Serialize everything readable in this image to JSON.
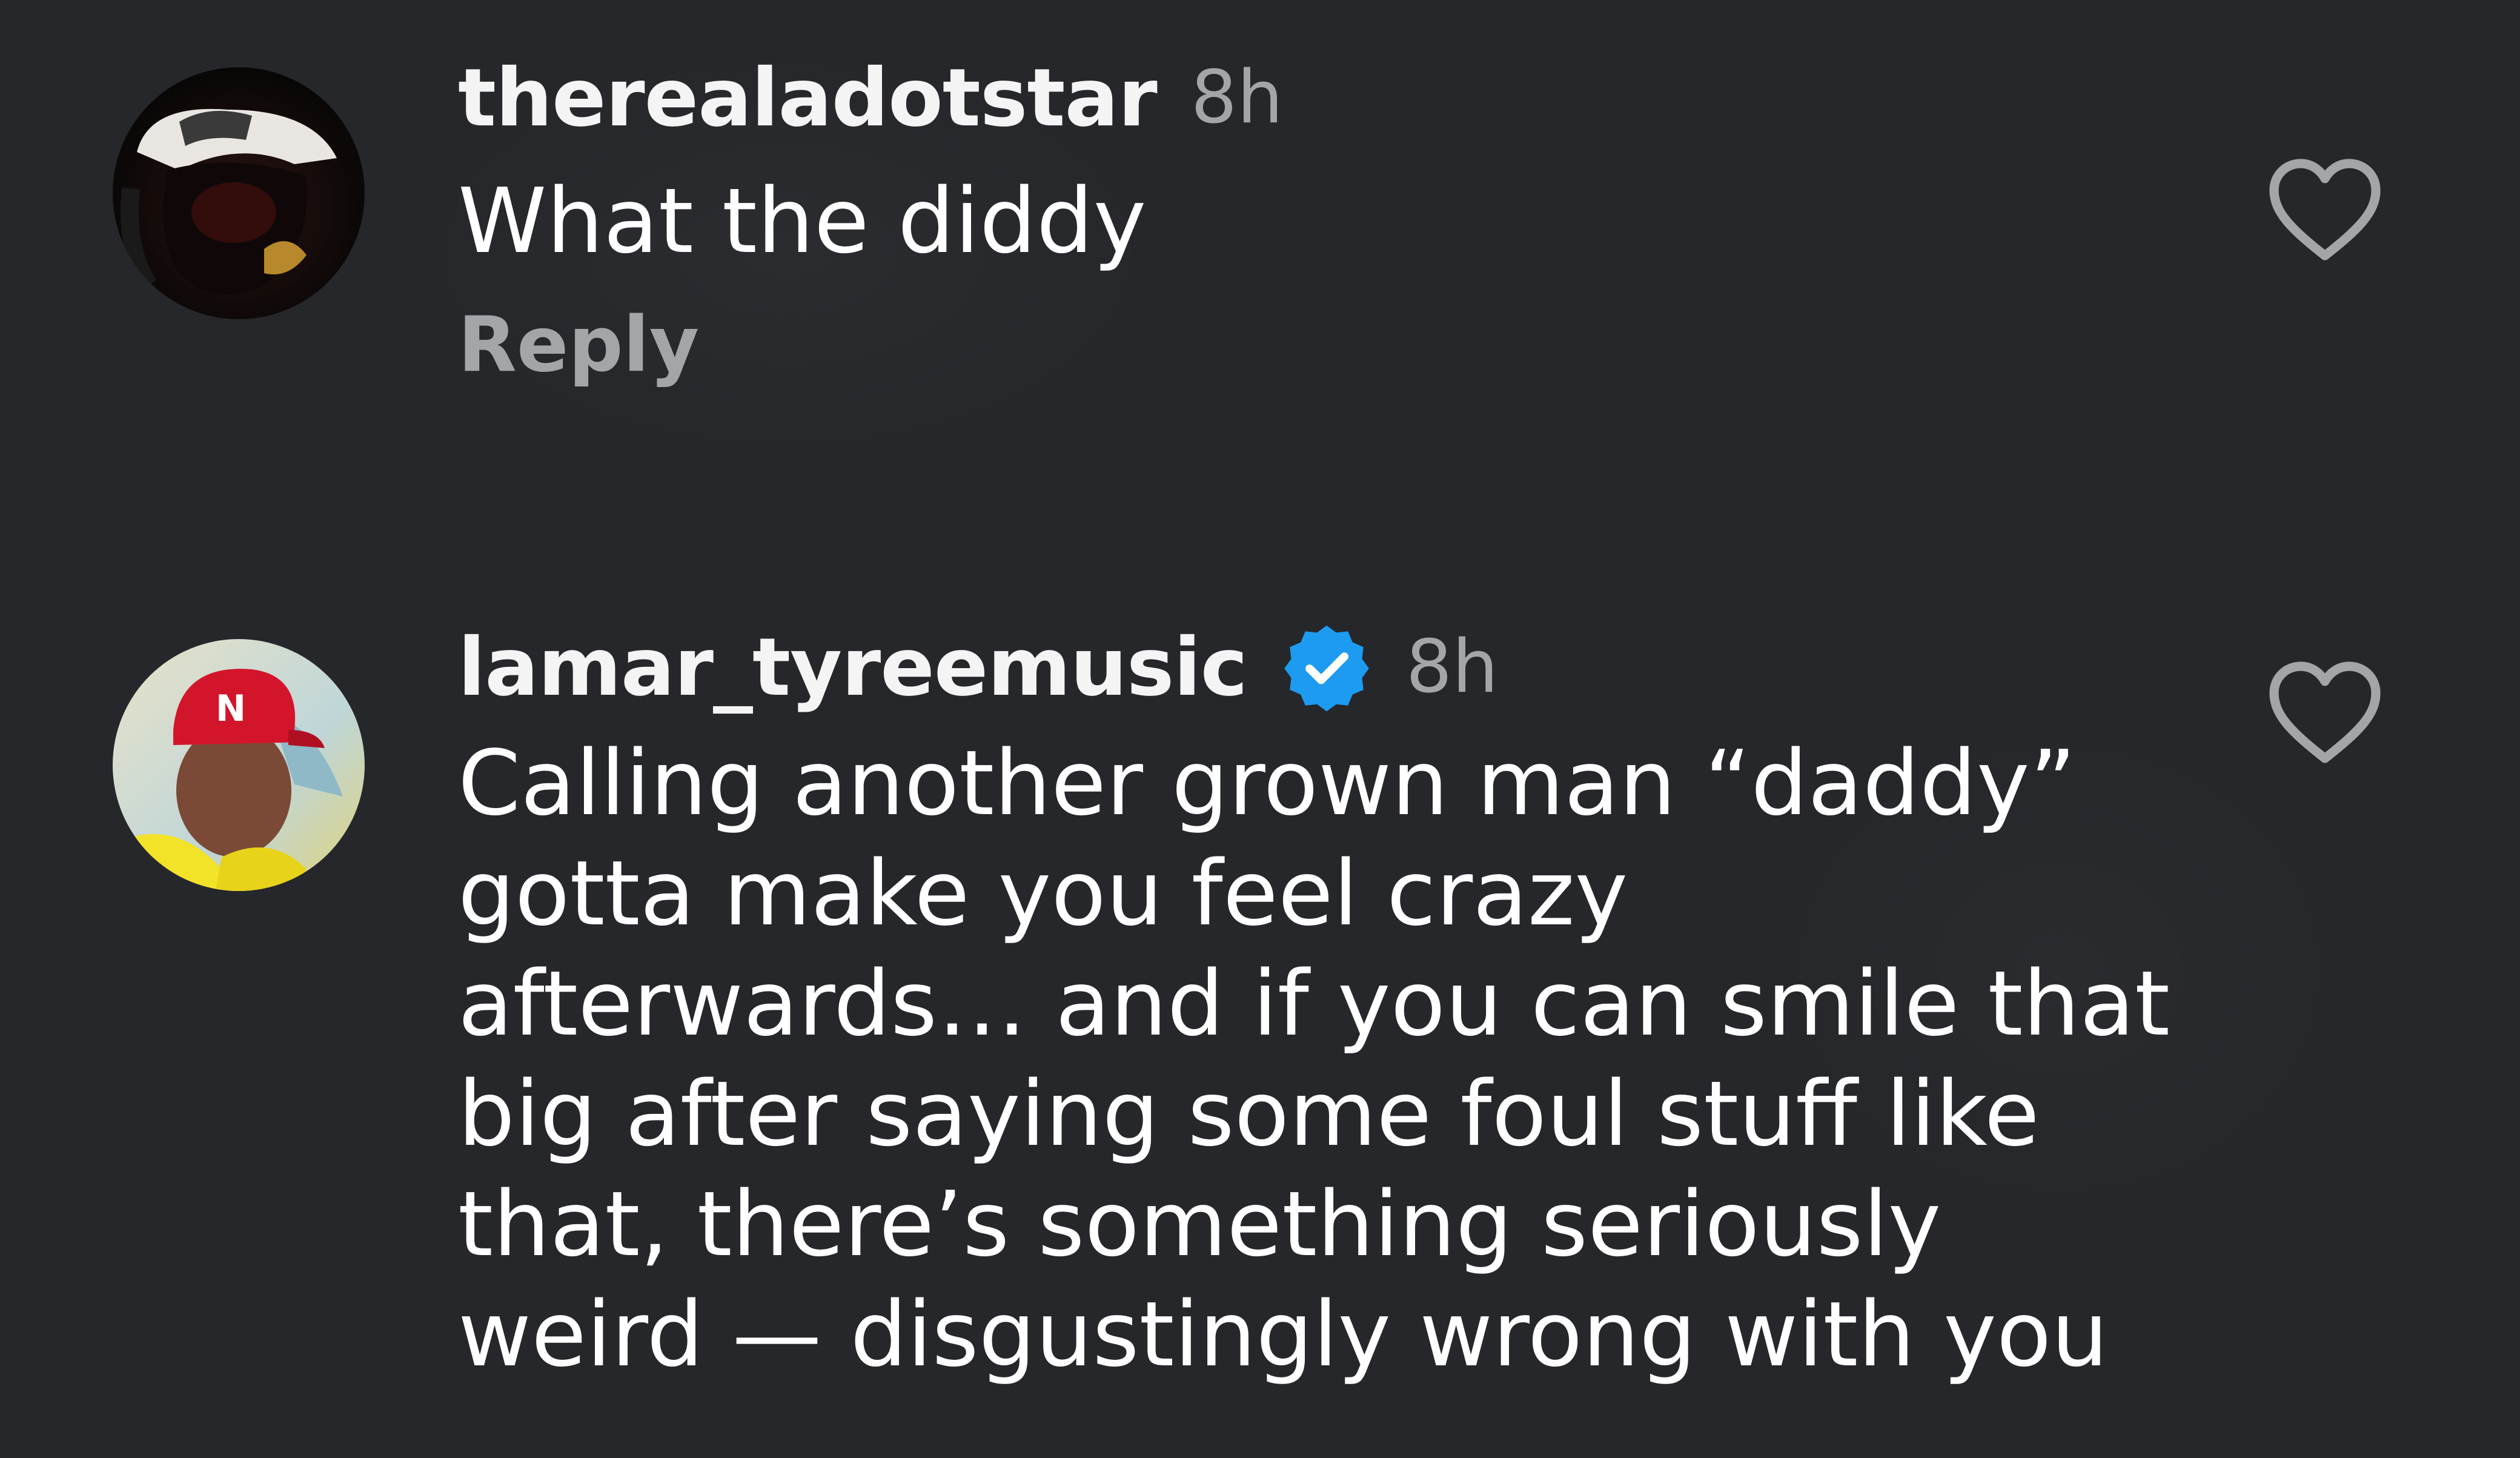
{
  "comments": [
    {
      "username": "therealadotstar",
      "time": "8h",
      "text": "What the diddy",
      "reply_label": "Reply",
      "verified": false,
      "avatar_icon": "avatar-dark-hoodie-cap"
    },
    {
      "username": "lamar_tyreemusic",
      "time": "8h",
      "text": "Calling another grown man “daddy” gotta make you feel crazy afterwards… and if you can smile that big after saying some foul stuff like that, there’s something seriously weird — disgustingly wrong with you",
      "verified": true,
      "avatar_icon": "avatar-red-ny-cap"
    }
  ],
  "icons": {
    "like": "heart-outline-icon",
    "verified": "verified-badge-icon"
  },
  "colors": {
    "background": "#25272b",
    "text_primary": "#ffffff",
    "text_secondary": "#a3a5a8",
    "verified_blue": "#1d9bf0"
  }
}
